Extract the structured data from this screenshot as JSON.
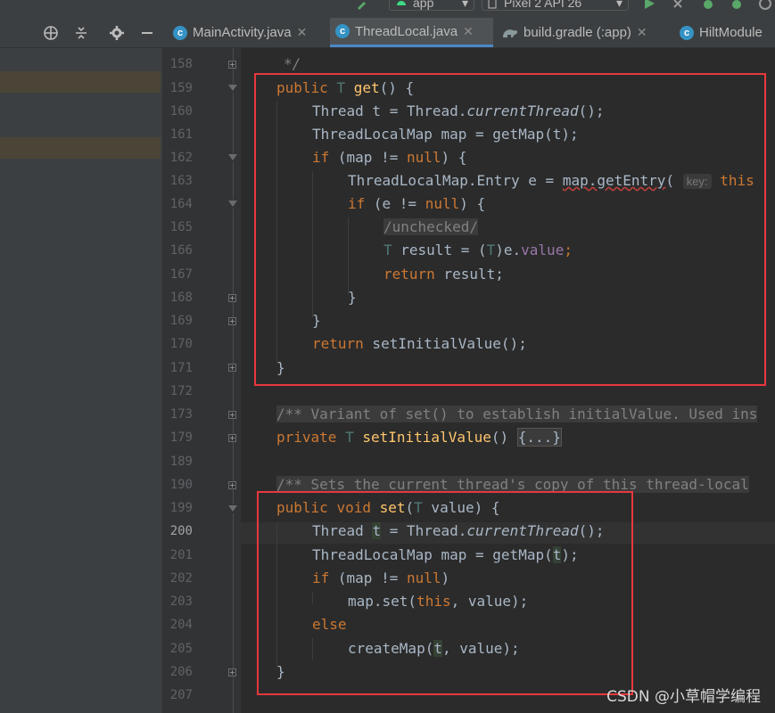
{
  "toolbar": {
    "module_label": "app",
    "device_label": "Pixel 2 API 26"
  },
  "tabs": [
    {
      "label": "MainActivity.java",
      "icon": "class-icon"
    },
    {
      "label": "ThreadLocal.java",
      "icon": "class-icon",
      "active": true
    },
    {
      "label": "build.gradle (:app)",
      "icon": "gradle-icon"
    },
    {
      "label": "HiltModule",
      "icon": "class-icon"
    }
  ],
  "gutter": {
    "line_numbers": [
      "158",
      "159",
      "160",
      "161",
      "162",
      "163",
      "164",
      "165",
      "166",
      "167",
      "168",
      "169",
      "170",
      "171",
      "172",
      "173",
      "179",
      "189",
      "190",
      "199",
      "200",
      "201",
      "202",
      "203",
      "204",
      "205",
      "206",
      "207"
    ],
    "current_line": "200"
  },
  "code": {
    "l158": "*/",
    "l159": {
      "kw": "public",
      "type": "T",
      "name": "get",
      "rest": "() {"
    },
    "l160": {
      "a": "Thread t = Thread.",
      "call": "currentThread",
      "b": "();"
    },
    "l161": "ThreadLocalMap map = getMap(t);",
    "l162": {
      "kw": "if",
      "a": " (map != ",
      "null": "null",
      "b": ") {"
    },
    "l163": {
      "a": "ThreadLocalMap.Entry e = ",
      "call": "map.getEntry",
      "paren": "(",
      "hint": "key:",
      "this": "this"
    },
    "l164": {
      "kw": "if",
      "a": " (e != ",
      "null": "null",
      "b": ") {"
    },
    "l165": "/unchecked/",
    "l166": {
      "type": "T",
      "a": " result = (",
      "type2": "T",
      "b": ")e.",
      "field": "value",
      "c": ";"
    },
    "l167": {
      "kw": "return",
      "a": " result;"
    },
    "l168": "}",
    "l169": "}",
    "l170": {
      "kw": "return",
      "a": " setInitialValue();"
    },
    "l171": "}",
    "l173": "/** Variant of set() to establish initialValue. Used ins",
    "l179": {
      "kw": "private",
      "type": "T",
      "name": "setInitialValue",
      "a": "() ",
      "fold": "{...}"
    },
    "l190": "/** Sets the current thread's copy of this thread-local",
    "l199": {
      "kw": "public",
      "kw2": "void",
      "name": "set",
      "a": "(",
      "type": "T",
      "b": " value) {"
    },
    "l200": {
      "a": "Thread ",
      "v": "t",
      "b": " = Thread.",
      "call": "currentThread",
      "c": "();"
    },
    "l201": {
      "a": "ThreadLocalMap map = getMap(",
      "v": "t",
      "b": ");"
    },
    "l202": {
      "kw": "if",
      "a": " (map != ",
      "null": "null",
      "b": ")"
    },
    "l203": {
      "a": "map.set(",
      "this": "this",
      "b": ", value);"
    },
    "l204": "else",
    "l205": {
      "a": "createMap(",
      "v": "t",
      "b": ", value);"
    },
    "l206": "}"
  },
  "watermark": "CSDN @小草帽学编程"
}
